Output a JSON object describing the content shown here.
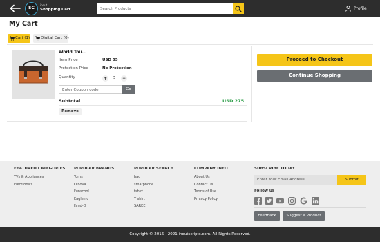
{
  "header": {
    "logo_initials": "SC",
    "logo_small": "inout",
    "logo_text": "Shopping Cart",
    "search_placeholder": "Search Products",
    "profile_label": "Profile"
  },
  "page_title": "My Cart",
  "tabs": [
    {
      "label": "Cart (1)",
      "active": true
    },
    {
      "label": "Digital Cart (0)",
      "active": false
    }
  ],
  "cart_item": {
    "name": "World Tou...",
    "price_label": "Item Price",
    "price_value": "USD 55",
    "protection_label": "Protection Price",
    "protection_value": "No Protection",
    "quantity_label": "Quantity",
    "quantity_plus": "+",
    "quantity_value": "5",
    "quantity_minus": "−",
    "coupon_placeholder": "Enter Coupon code",
    "go_label": "Go",
    "subtotal_label": "Subtotal",
    "subtotal_value": "USD  275",
    "remove_label": "Remove"
  },
  "checkout": {
    "proceed_label": "Proceed to Checkout",
    "continue_label": "Continue Shopping"
  },
  "footer": {
    "columns": [
      {
        "heading": "FEATURED CATEGORIES",
        "links": [
          "TVs & Appliances",
          "Electronics"
        ]
      },
      {
        "heading": "POPULAR BRANDS",
        "links": [
          "Toms",
          "Oinova",
          "Funscool",
          "Eagleinc",
          "Fand-D"
        ]
      },
      {
        "heading": "POPULAR SEARCH",
        "links": [
          "bag",
          "smarphone",
          "tshirt",
          "T shirt",
          "SAREE"
        ]
      },
      {
        "heading": "COMPANY INFO",
        "links": [
          "About Us",
          "Contact Us",
          "Terms of Use",
          "Privacy Policy"
        ]
      }
    ],
    "subscribe_heading": "SUBSCRIBE TODAY",
    "email_placeholder": "Enter Your Email Address",
    "submit_label": "Submit",
    "follow_heading": "Follow us",
    "social_icons": [
      "facebook-icon",
      "twitter-icon",
      "youtube-icon",
      "instagram-icon",
      "google-icon",
      "linkedin-icon"
    ],
    "feedback_label": "Feedback",
    "suggest_label": "Suggest a Product",
    "copyright": "Copyright © 2016 - 2021 inoutscripts.com. All Rights Reserved."
  },
  "colors": {
    "header_bg": "#2d2d2d",
    "accent_yellow": "#f5c518",
    "button_gray": "#6a6e72",
    "price_green": "#2e9e4a",
    "footer_bg": "#eeeeee"
  }
}
